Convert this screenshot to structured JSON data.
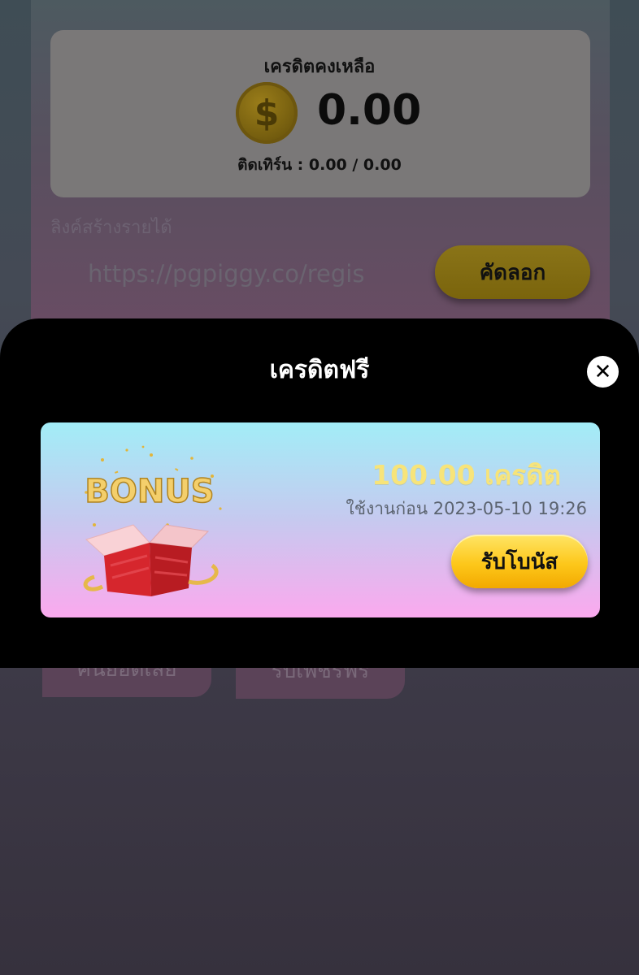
{
  "wallet": {
    "title": "เครดิตคงเหลือ",
    "balance": "0.00",
    "coin_icon": "dollar-coin-icon",
    "turnover": "ติดเทิร์น : 0.00 / 0.00"
  },
  "referral": {
    "label": "ลิงค์สร้างรายได้",
    "link": "https://pgpiggy.co/register",
    "copy_label": "คัดลอก"
  },
  "bottom_buttons": {
    "left_label": "คืนยอดเสีย",
    "right_label": "รับเพชรฟรี"
  },
  "modal": {
    "title": "เครดิตฟรี",
    "close_icon": "close-icon",
    "bonus": {
      "image_text": "BONUS",
      "amount": "100.00 เครดิต",
      "expiry": "ใช้งานก่อน 2023-05-10 19:26",
      "claim_label": "รับโบนัส"
    }
  },
  "colors": {
    "modal_bg": "#000000",
    "claim_button": "#fdc71a",
    "bonus_amount": "#f7e47a",
    "card_gradient_top": "#a2edf7",
    "card_gradient_bottom": "#fba9ee"
  }
}
